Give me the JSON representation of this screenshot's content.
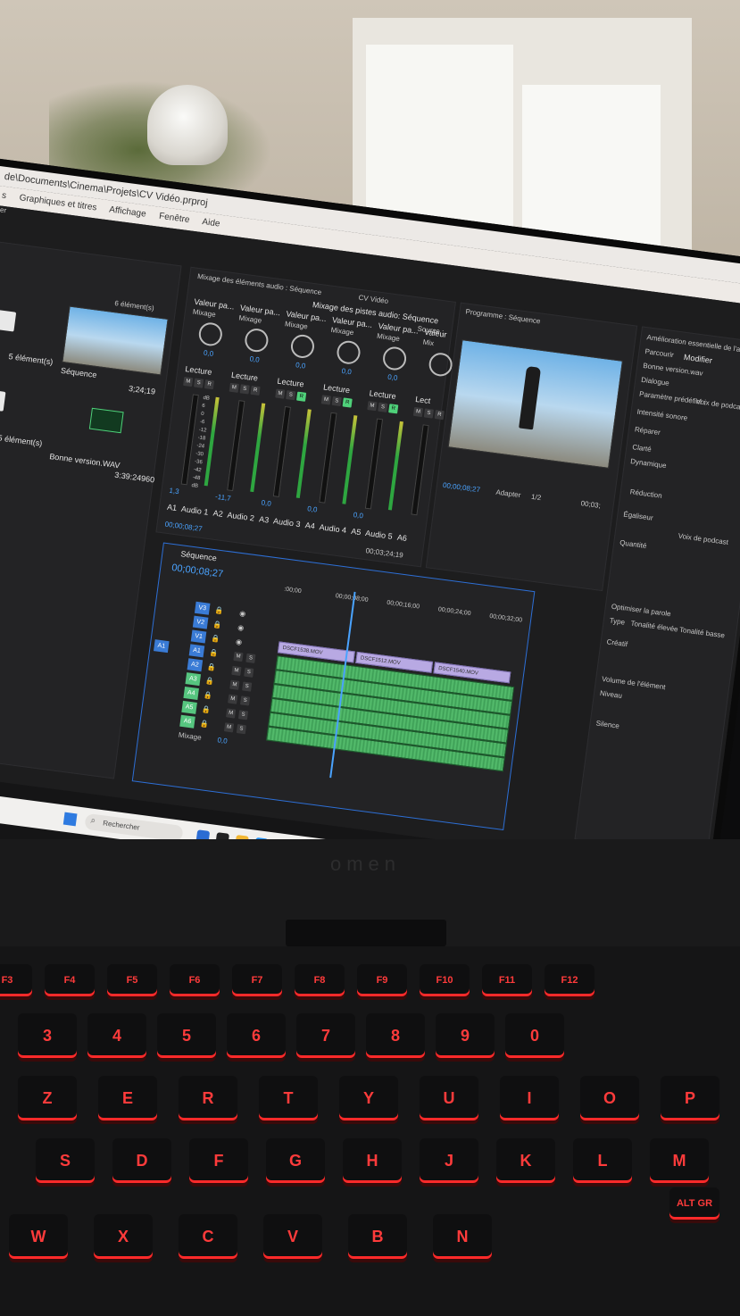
{
  "window": {
    "path": "de\\Documents\\Cinema\\Projets\\CV Vidéo.prproj"
  },
  "menu": [
    "s",
    "Graphiques et titres",
    "Affichage",
    "Fenêtre",
    "Aide"
  ],
  "left_menu_fragment": "er",
  "project_panel": {
    "count": "6 élément(s)",
    "items": [
      {
        "label": "5 élément(s)",
        "type": "folder"
      },
      {
        "label": "Séquence",
        "duration": "3;24;19",
        "type": "sequence"
      },
      {
        "label": "5 élément(s)",
        "type": "folder"
      },
      {
        "label": "Bonne version.WAV",
        "duration": "3:39:24960",
        "type": "audio"
      }
    ]
  },
  "app_title": "CV Vidéo",
  "audio_clip_mixer": {
    "title": "Mixage des éléments audio : Séquence",
    "tab": "Mixage des pistes audio: Séquence",
    "source_tab": "Source :",
    "channels": [
      {
        "id": "A1",
        "name": "Audio 1",
        "mode": "Valeur pa...",
        "mix": "Mixage",
        "value": "0,0",
        "read": "Lecture",
        "fader": "1,3"
      },
      {
        "id": "A2",
        "name": "Audio 2",
        "mode": "Valeur pa...",
        "mix": "Mixage",
        "value": "0,0",
        "read": "Lecture",
        "fader": "-11,7"
      },
      {
        "id": "A3",
        "name": "Audio 3",
        "mode": "Valeur pa...",
        "mix": "Mixage",
        "value": "0,0",
        "read": "Lecture",
        "fader": "0,0"
      },
      {
        "id": "A4",
        "name": "Audio 4",
        "mode": "Valeur pa...",
        "mix": "Mixage",
        "value": "0,0",
        "read": "Lecture",
        "fader": "0,0"
      },
      {
        "id": "A5",
        "name": "Audio 5",
        "mode": "Valeur pa...",
        "mix": "Mixage",
        "value": "0,0",
        "read": "Lecture",
        "fader": "0,0"
      },
      {
        "id": "A6",
        "name": "",
        "mode": "Valeur",
        "mix": "Mix",
        "value": "",
        "read": "Lect",
        "fader": ""
      }
    ],
    "timecode": "00;00;08;27",
    "end_time": "00;03;24;19",
    "meter_scale": [
      "dB",
      "6",
      "0",
      "-6",
      "-12",
      "-18",
      "-24",
      "-30",
      "-36",
      "-42",
      "-48",
      "dB"
    ]
  },
  "program_monitor": {
    "title": "Programme : Séquence",
    "timecode": "00;00;08;27",
    "fit": "Adapter",
    "ratio": "1/2",
    "end": "00;03;"
  },
  "essential_sound": {
    "title": "Amélioration essentielle de l'audio",
    "tabs": [
      "Parcourir",
      "Modifier"
    ],
    "preset": "Bonne version.wav",
    "type": "Dialogue",
    "preset_label": "Paramètre prédéfini :",
    "preset_value": "Voix de podcast",
    "loudness": "Intensité sonore",
    "repair": "Réparer",
    "clarity": "Clarté",
    "dynamic": "Dynamique",
    "reduction": "Réduction",
    "eq": "Égaliseur",
    "eq_preset": "Voix de podcast",
    "amount": "Quantité",
    "optimize": "Optimiser la parole",
    "type_label": "Type",
    "tone_high": "Tonalité élevée",
    "tone_low": "Tonalité basse",
    "creative": "Créatif",
    "clip_volume": "Volume de l'élément",
    "level": "Niveau",
    "mute": "Silence"
  },
  "timeline": {
    "tab": "Séquence",
    "timecode": "00;00;08;27",
    "ruler": [
      ":00;00",
      "00;00;08;00",
      "00;00;16;00",
      "00;00;24;00",
      "00;00;32;00"
    ],
    "video_tracks": [
      "V3",
      "V2",
      "V1"
    ],
    "audio_tracks": [
      "A1",
      "A2",
      "A3",
      "A4",
      "A5",
      "A6"
    ],
    "source_patch": "A1",
    "mix_label": "Mixage",
    "mix_value": "0,0",
    "clips": [
      "DSCF1538.MOV",
      "DSCF1512.MOV",
      "DSCF1540.MOV"
    ]
  },
  "taskbar": {
    "search_placeholder": "Rechercher"
  },
  "laptop": {
    "brand": "omen",
    "keys": [
      "F3",
      "F4",
      "F5",
      "F6",
      "F7",
      "F8",
      "F9",
      "F10",
      "F11",
      "F12",
      "3",
      "4",
      "5",
      "6",
      "7",
      "8",
      "9",
      "0",
      "Z",
      "E",
      "R",
      "T",
      "Y",
      "U",
      "I",
      "O",
      "P",
      "S",
      "D",
      "F",
      "G",
      "H",
      "J",
      "K",
      "L",
      "M",
      "W",
      "X",
      "C",
      "V",
      "B",
      "N",
      "ALT GR"
    ]
  },
  "colors": {
    "accent_blue": "#2d8cff",
    "audio_clip": "#4cbf6a",
    "video_clip": "#b8a9e3",
    "keyboard_backlight": "#ff2a2a"
  }
}
